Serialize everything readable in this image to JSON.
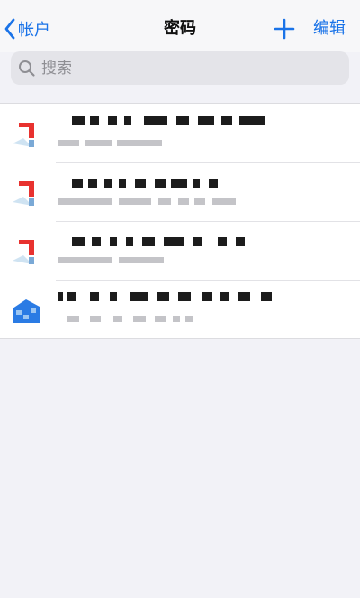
{
  "nav": {
    "back_label": "帐户",
    "title": "密码",
    "edit_label": "编辑"
  },
  "search": {
    "placeholder": "搜索"
  },
  "accounts": [
    {
      "favicon": "red-logo-icon"
    },
    {
      "favicon": "red-logo-icon"
    },
    {
      "favicon": "red-logo-icon"
    },
    {
      "favicon": "blue-logo-icon"
    }
  ],
  "colors": {
    "accent": "#1a73e8",
    "background": "#f2f2f7",
    "search_bg": "#e4e4e9",
    "red_logo": "#e8322f",
    "blue_logo": "#2a7be4"
  }
}
